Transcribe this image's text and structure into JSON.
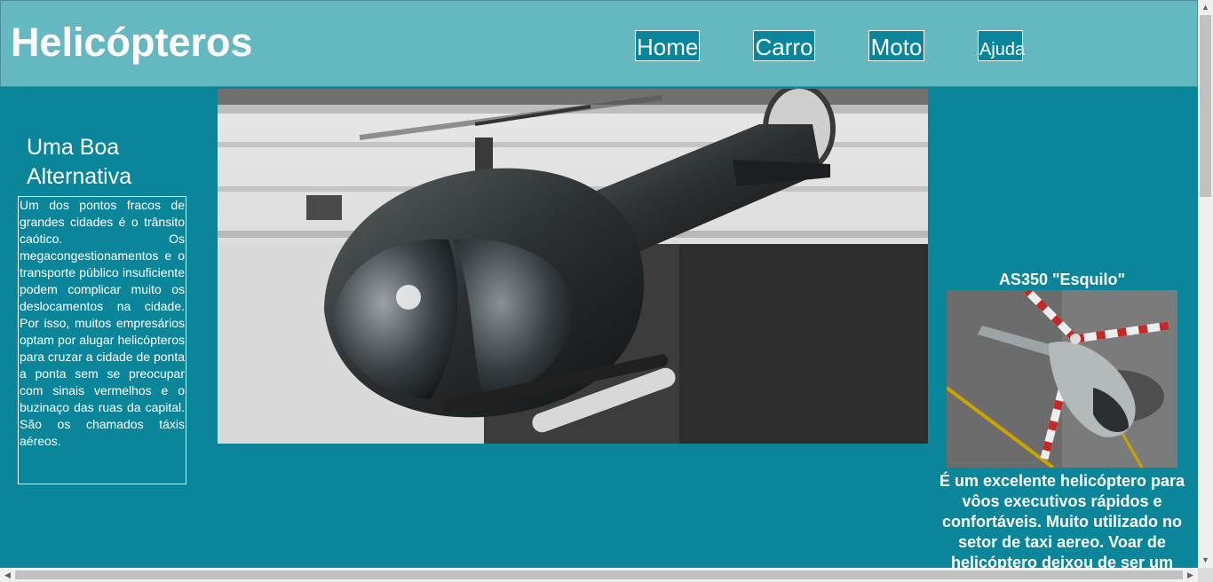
{
  "header": {
    "title": "Helicópteros",
    "nav": [
      "Home",
      "Carro",
      "Moto",
      "Ajuda"
    ]
  },
  "aside": {
    "title": "Uma Boa Alternativa",
    "text": "Um dos pontos fracos de grandes cidades é o trânsito caótico. Os megacongestionamentos e o transporte público insuficiente podem complicar muito os deslocamentos na cidade. Por isso, muitos empresários optam por alugar helicópteros para cruzar a cidade de ponta a ponta sem se preocupar com sinais vermelhos e o buzinaço das ruas da capital. São os chamados táxis aéreos."
  },
  "card": {
    "title": "AS350 \"Esquilo\"",
    "text": "É um excelente helicóptero para vôos executivos rápidos e confortáveis. Muito utilizado no setor de taxi aereo. Voar de helicóptero deixou de ser um"
  },
  "icons": {
    "scroll_up": "arrow-up-icon",
    "scroll_down": "arrow-down-icon",
    "scroll_left": "arrow-left-icon",
    "scroll_right": "arrow-right-icon"
  },
  "colors": {
    "page_bg": "#0a8599",
    "header_bg": "#65b8bf",
    "text": "#ffffff"
  }
}
